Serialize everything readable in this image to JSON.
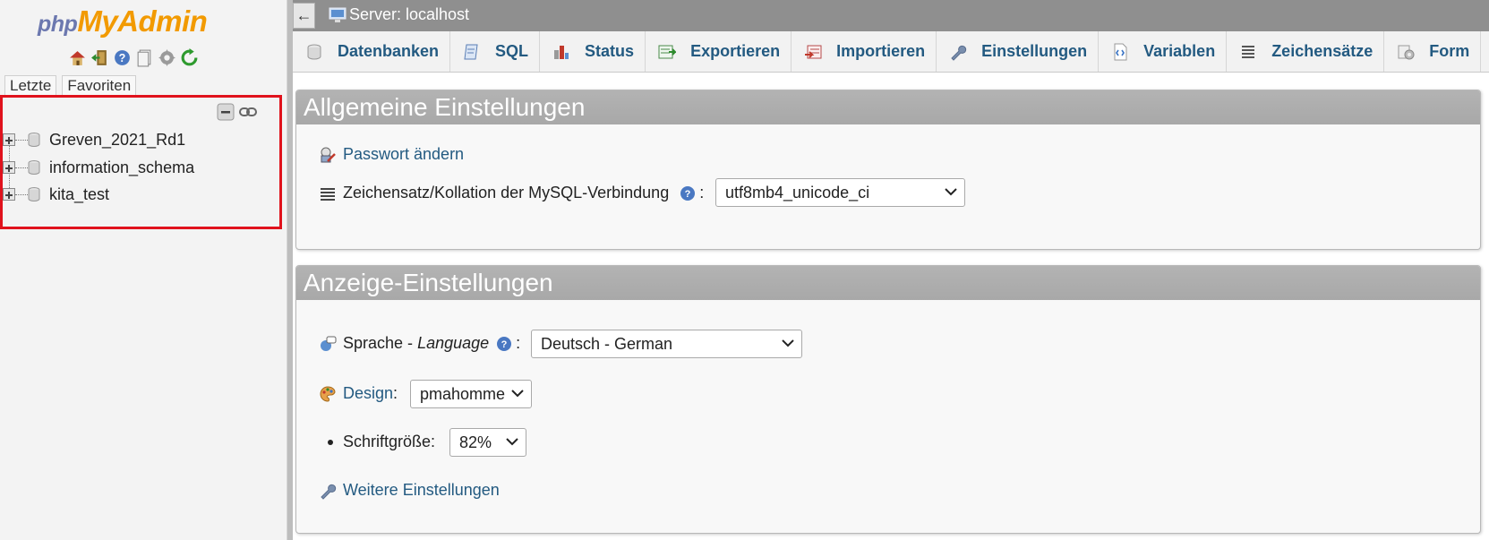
{
  "nav": {
    "logo_php": "php",
    "logo_myadmin": "MyAdmin",
    "quick_icons": [
      "home-icon",
      "logout-icon",
      "help-icon",
      "docs-icon",
      "settings-icon",
      "reload-icon"
    ],
    "tabs": [
      {
        "label": "Letzte"
      },
      {
        "label": "Favoriten"
      }
    ],
    "databases": [
      {
        "name": "Greven_2021_Rd1"
      },
      {
        "name": "information_schema"
      },
      {
        "name": "kita_test"
      }
    ]
  },
  "topbar": {
    "back_symbol": "←",
    "server_label": "Server: localhost"
  },
  "menu": [
    {
      "label": "Datenbanken",
      "icon": "database-icon"
    },
    {
      "label": "SQL",
      "icon": "sql-icon"
    },
    {
      "label": "Status",
      "icon": "status-icon"
    },
    {
      "label": "Exportieren",
      "icon": "export-icon"
    },
    {
      "label": "Importieren",
      "icon": "import-icon"
    },
    {
      "label": "Einstellungen",
      "icon": "wrench-icon"
    },
    {
      "label": "Variablen",
      "icon": "variables-icon"
    },
    {
      "label": "Zeichensätze",
      "icon": "charset-icon"
    },
    {
      "label": "Form",
      "icon": "engines-icon"
    }
  ],
  "general": {
    "title": "Allgemeine Einstellungen",
    "password_link": "Passwort ändern",
    "collation_label": "Zeichensatz/Kollation der MySQL-Verbindung",
    "collation_colon": ":",
    "collation_value": "utf8mb4_unicode_ci"
  },
  "display": {
    "title": "Anzeige-Einstellungen",
    "language_label": "Sprache -",
    "language_label_en": "Language",
    "language_colon": ":",
    "language_value": "Deutsch - German",
    "design_label": "Design",
    "design_colon": ":",
    "design_value": "pmahomme",
    "fontsize_label": "Schriftgröße:",
    "fontsize_value": "82%",
    "more_link": "Weitere Einstellungen"
  },
  "colors": {
    "link": "#235a81",
    "logo_php": "#6c78af",
    "logo_myadmin": "#f29a00",
    "highlight_border": "#e0121c",
    "panel_header": "#aaaaaa"
  }
}
